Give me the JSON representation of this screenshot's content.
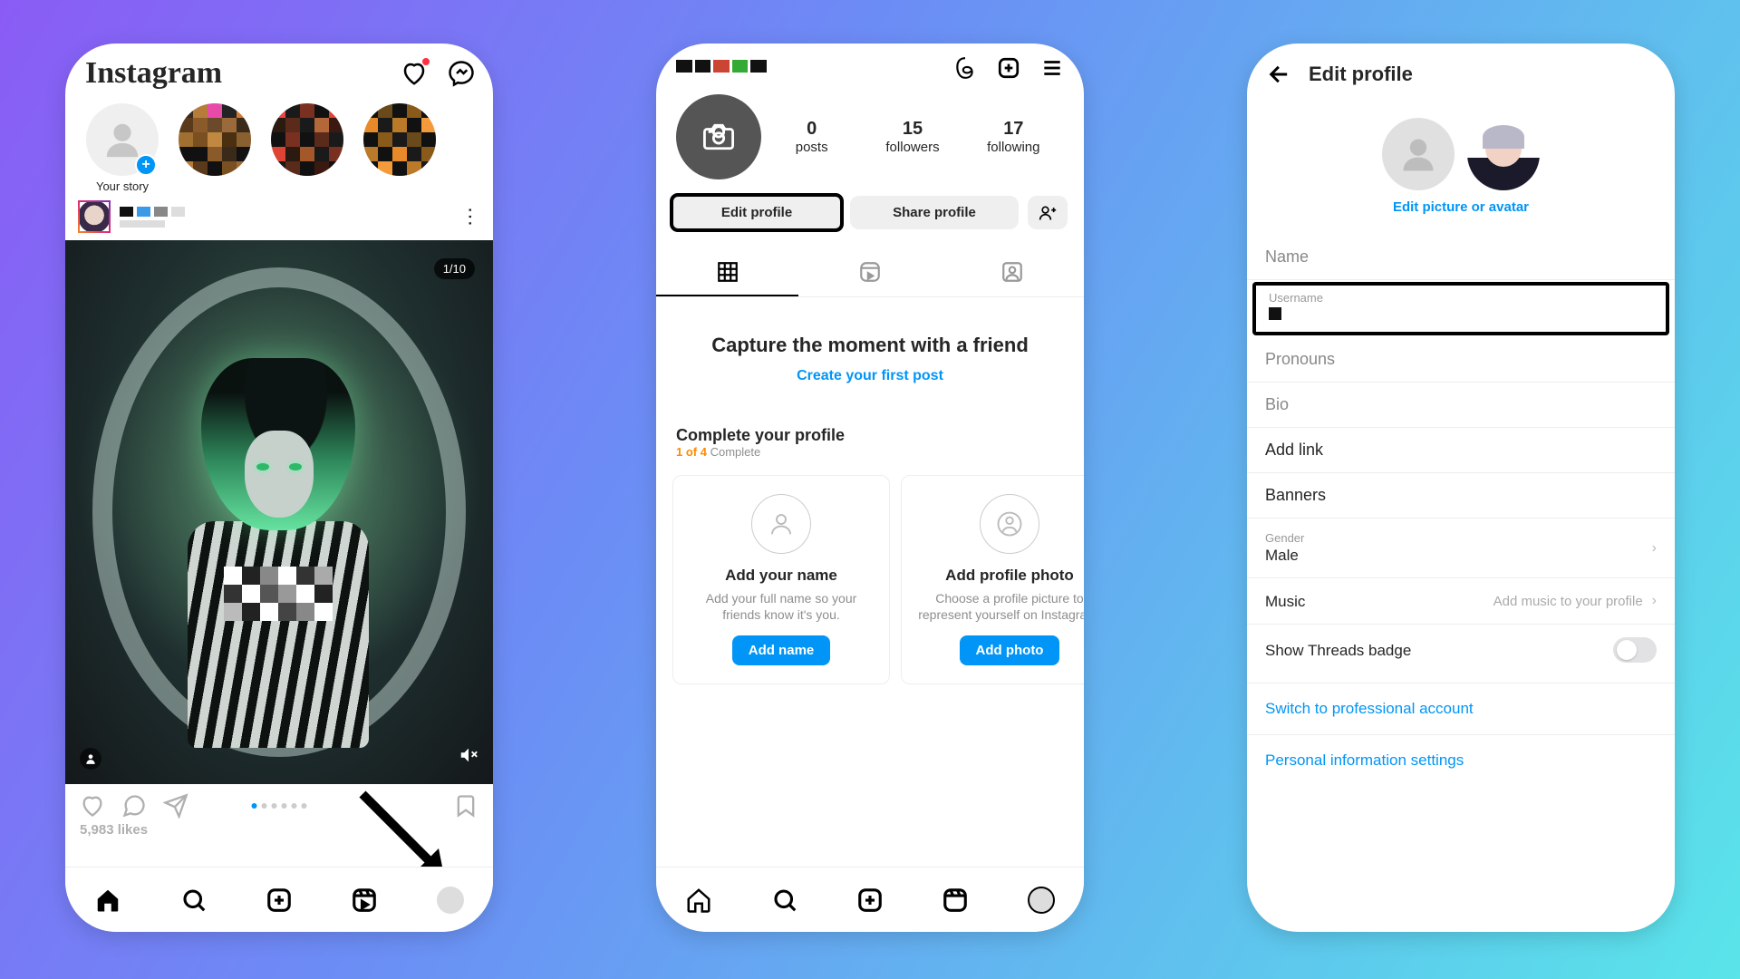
{
  "phone1": {
    "logo": "Instagram",
    "your_story": "Your story",
    "post_counter": "1/10",
    "likes": "5,983 likes"
  },
  "phone2": {
    "stats": {
      "posts_n": "0",
      "posts_l": "posts",
      "followers_n": "15",
      "followers_l": "followers",
      "following_n": "17",
      "following_l": "following"
    },
    "edit_profile": "Edit profile",
    "share_profile": "Share profile",
    "capture_h": "Capture the moment with a friend",
    "capture_link": "Create your first post",
    "complete_h": "Complete your profile",
    "complete_progress": "1 of 4",
    "complete_suffix": " Complete",
    "cards": {
      "name_t": "Add your name",
      "name_d": "Add your full name so your friends know it's you.",
      "name_b": "Add name",
      "photo_t": "Add profile photo",
      "photo_d": "Choose a profile picture to represent yourself on Instagram.",
      "photo_b": "Add photo"
    }
  },
  "phone3": {
    "title": "Edit profile",
    "edit_link": "Edit picture or avatar",
    "name": "Name",
    "username_lbl": "Username",
    "pronouns": "Pronouns",
    "bio": "Bio",
    "add_link": "Add link",
    "banners": "Banners",
    "gender_lbl": "Gender",
    "gender_val": "Male",
    "music": "Music",
    "music_hint": "Add music to your profile",
    "threads": "Show Threads badge",
    "switch_pro": "Switch to professional account",
    "personal_info": "Personal information settings"
  }
}
